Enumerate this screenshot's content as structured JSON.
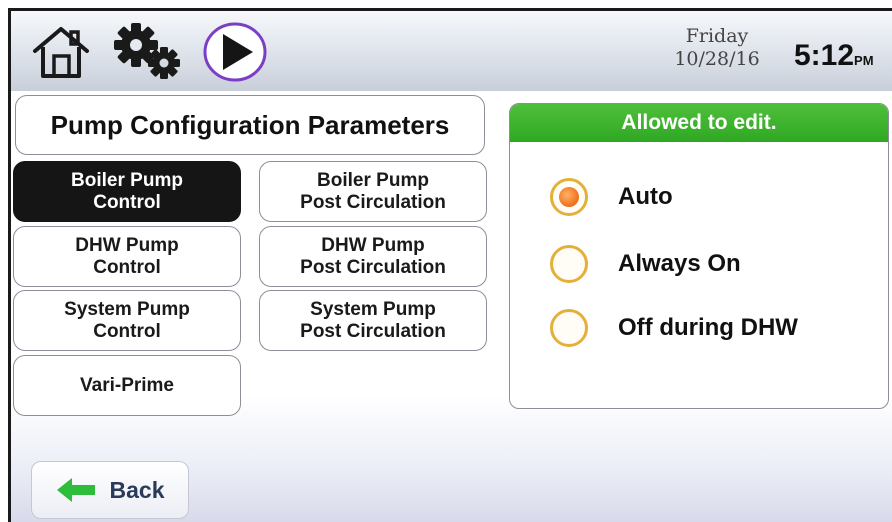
{
  "header": {
    "icons": [
      "home-icon",
      "gear-icon",
      "play-icon"
    ],
    "day": "Friday",
    "date": "10/28/16",
    "time": "5:12",
    "ampm": "PM"
  },
  "page_title": "Pump Configuration Parameters",
  "menu": [
    {
      "line1": "Boiler Pump",
      "line2": "Control",
      "selected": true
    },
    {
      "line1": "Boiler Pump",
      "line2": "Post Circulation",
      "selected": false
    },
    {
      "line1": "DHW Pump",
      "line2": "Control",
      "selected": false
    },
    {
      "line1": "DHW Pump",
      "line2": "Post Circulation",
      "selected": false
    },
    {
      "line1": "System Pump",
      "line2": "Control",
      "selected": false
    },
    {
      "line1": "System Pump",
      "line2": "Post Circulation",
      "selected": false
    },
    {
      "line1": "Vari-Prime",
      "line2": "",
      "selected": false
    }
  ],
  "panel": {
    "header": "Allowed to edit.",
    "header_color": "#35ab27",
    "options": [
      {
        "label": "Auto",
        "selected": true
      },
      {
        "label": "Always On",
        "selected": false
      },
      {
        "label": "Off during DHW",
        "selected": false
      }
    ],
    "radio_color": "#e3b03a",
    "radio_selected_color": "#f0731f"
  },
  "back_button": {
    "label": "Back",
    "icon": "back-arrow-icon",
    "icon_color": "#2ebd3a"
  }
}
